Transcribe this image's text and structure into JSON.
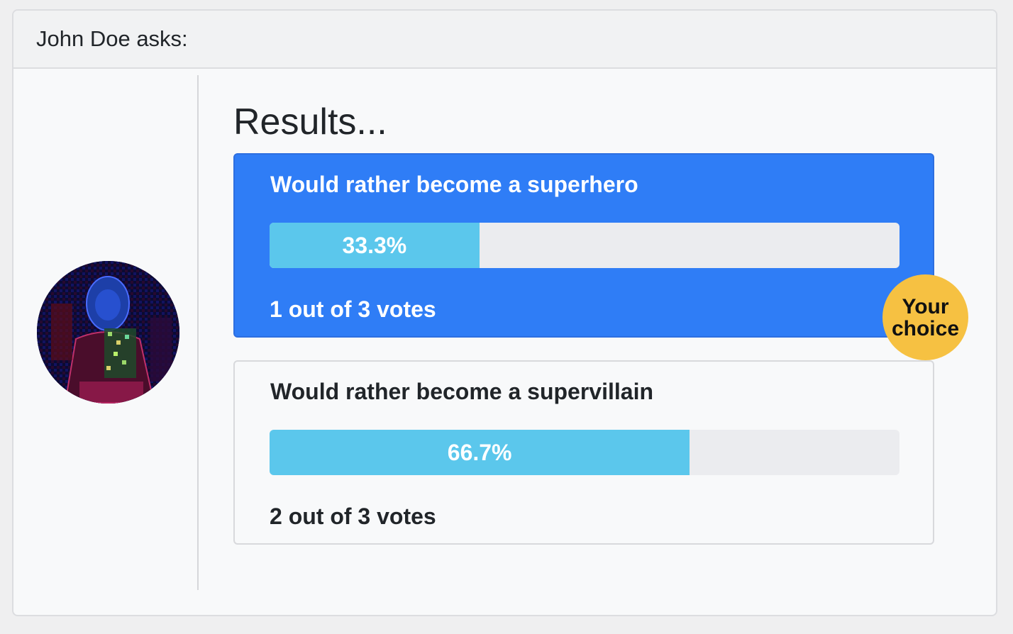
{
  "header": {
    "asker": "John Doe asks:"
  },
  "results_title": "Results...",
  "options": [
    {
      "text": "Would rather become a superhero",
      "percent_label": "33.3%",
      "percent": 33.3,
      "votes_text": "1 out of 3 votes",
      "chosen": true
    },
    {
      "text": "Would rather become a supervillain",
      "percent_label": "66.7%",
      "percent": 66.7,
      "votes_text": "2 out of 3 votes",
      "chosen": false
    }
  ],
  "badge": {
    "line1": "Your",
    "line2": "choice"
  },
  "colors": {
    "chosen_bg": "#2f7df6",
    "progress_fill": "#5bc7ec",
    "progress_track": "#ebecef",
    "badge_bg": "#f6c142"
  },
  "icons": {
    "avatar": "user-avatar-image"
  }
}
